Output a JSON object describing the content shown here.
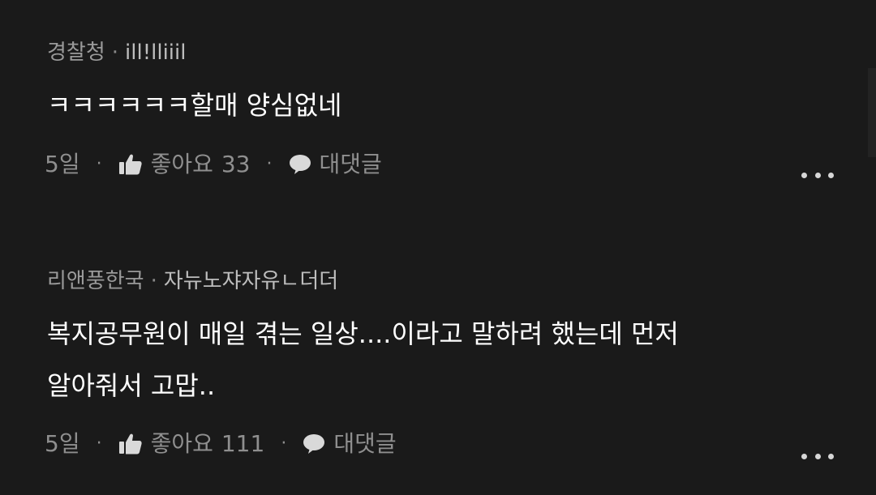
{
  "comments": [
    {
      "author": "경찰청",
      "separator": "·",
      "username": "ill!lliiil",
      "text_lines": [
        "ㅋㅋㅋㅋㅋㅋ할매 양심없네"
      ],
      "age": "5일",
      "like_label": "좋아요",
      "like_count": "33",
      "reply_label": "대댓글",
      "more_icon": "more-horizontal-icon"
    },
    {
      "author": "리앤풍한국",
      "separator": "·",
      "username": "자뉴노쟈자유ㄴ더더",
      "text_lines": [
        "복지공무원이 매일 겪는 일상....이라고 말하려 했는데 먼저",
        "알아줘서 고맙.."
      ],
      "age": "5일",
      "like_label": "좋아요",
      "like_count": "111",
      "reply_label": "대댓글",
      "more_icon": "more-horizontal-icon"
    }
  ],
  "icons": {
    "like": "thumbs-up-icon",
    "reply": "speech-bubble-icon"
  },
  "colors": {
    "background": "#1a1a1a",
    "text": "#ffffff",
    "meta": "#9a9a9a"
  }
}
